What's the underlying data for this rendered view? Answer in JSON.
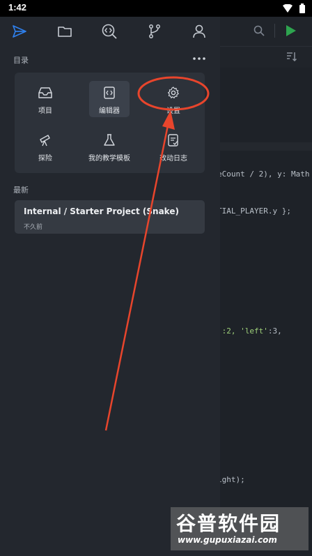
{
  "status_bar": {
    "time": "1:42"
  },
  "editor_bg": {
    "code_lines": [
      {
        "text_plain": "eCount / 2), y: Math"
      },
      {
        "text_plain": "TIAL_PLAYER.y };"
      },
      {
        "str": "':2, ",
        "key": "'left'",
        "tail": ":3,"
      },
      {
        "text_plain": "ight);"
      }
    ]
  },
  "drawer": {
    "nav_icons": [
      "send-icon",
      "folder-icon",
      "code-search-icon",
      "git-branch-icon",
      "user-icon"
    ],
    "catalog_label": "目录",
    "grid": [
      {
        "label": "项目",
        "icon": "inbox-icon"
      },
      {
        "label": "编辑器",
        "icon": "code-icon",
        "active": true
      },
      {
        "label": "设置",
        "icon": "gear-icon"
      },
      {
        "label": "探险",
        "icon": "telescope-icon"
      },
      {
        "label": "我的教学模板",
        "icon": "flask-icon"
      },
      {
        "label": "改动日志",
        "icon": "changelog-icon"
      }
    ],
    "recent_label": "最新",
    "recent_item": {
      "title": "Internal / Starter Project (Snake)",
      "subtitle": "不久前"
    }
  },
  "watermark": {
    "line1": "谷普软件园",
    "line2": "www.gupuxiazai.com"
  },
  "colors": {
    "accent": "#2f80ed",
    "annotation": "#e8452c",
    "run": "#2ea44f"
  }
}
